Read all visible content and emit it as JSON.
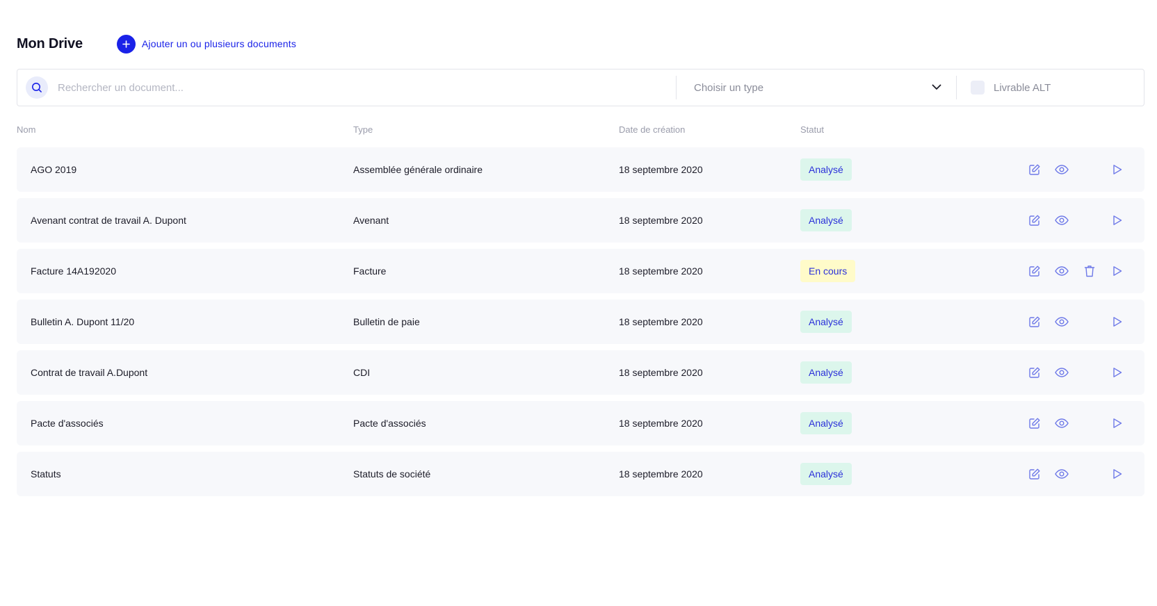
{
  "header": {
    "title": "Mon Drive",
    "add_button_label": "Ajouter un ou plusieurs documents"
  },
  "filters": {
    "search_placeholder": "Rechercher un document...",
    "search_value": "",
    "type_select_label": "Choisir un type",
    "livrable_label": "Livrable ALT",
    "livrable_checked": false
  },
  "table": {
    "columns": [
      "Nom",
      "Type",
      "Date de création",
      "Statut"
    ],
    "rows": [
      {
        "name": "AGO 2019",
        "type": "Assemblée générale ordinaire",
        "date": "18 septembre 2020",
        "status": "Analysé",
        "status_kind": "analyse",
        "deletable": false
      },
      {
        "name": "Avenant contrat de travail A. Dupont",
        "type": "Avenant",
        "date": "18 septembre 2020",
        "status": "Analysé",
        "status_kind": "analyse",
        "deletable": false
      },
      {
        "name": "Facture 14A192020",
        "type": "Facture",
        "date": "18 septembre 2020",
        "status": "En cours",
        "status_kind": "encours",
        "deletable": true
      },
      {
        "name": "Bulletin A. Dupont 11/20",
        "type": "Bulletin de paie",
        "date": "18 septembre 2020",
        "status": "Analysé",
        "status_kind": "analyse",
        "deletable": false
      },
      {
        "name": "Contrat de travail A.Dupont",
        "type": "CDI",
        "date": "18 septembre 2020",
        "status": "Analysé",
        "status_kind": "analyse",
        "deletable": false
      },
      {
        "name": "Pacte d'associés",
        "type": "Pacte d'associés",
        "date": "18 septembre 2020",
        "status": "Analysé",
        "status_kind": "analyse",
        "deletable": false
      },
      {
        "name": "Statuts",
        "type": "Statuts de société",
        "date": "18 septembre 2020",
        "status": "Analysé",
        "status_kind": "analyse",
        "deletable": false
      }
    ]
  },
  "icons": {
    "add": "plus-icon",
    "search": "search-icon",
    "select": "chevron-down-icon",
    "row_actions": [
      "edit-icon",
      "eye-icon",
      "trash-icon",
      "play-icon"
    ]
  },
  "colors": {
    "accent": "#1a22e8",
    "icon": "#6e79e8",
    "badge_analyse_bg": "#dcf6ec",
    "badge_encours_bg": "#fffbc9",
    "row_bg": "#f7f8fb"
  }
}
